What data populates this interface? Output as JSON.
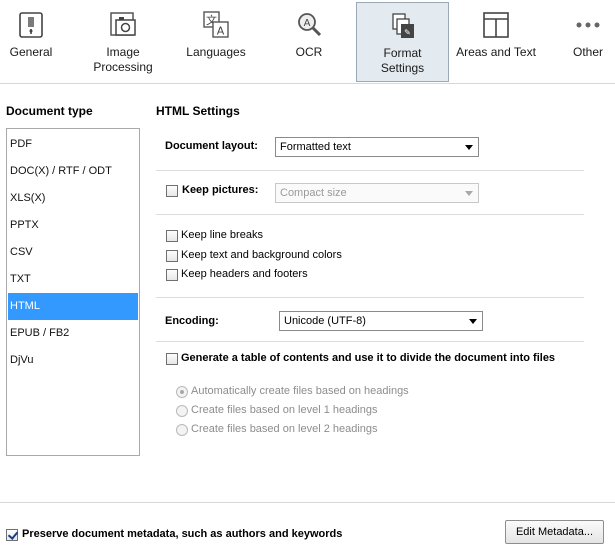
{
  "toolbar": {
    "items": [
      {
        "label": "General",
        "icon": "general-icon"
      },
      {
        "label": "Image\nProcessing",
        "icon": "image-processing-icon"
      },
      {
        "label": "Languages",
        "icon": "languages-icon"
      },
      {
        "label": "OCR",
        "icon": "ocr-icon"
      },
      {
        "label": "Format\nSettings",
        "icon": "format-settings-icon",
        "active": true
      },
      {
        "label": "Areas and Text",
        "icon": "areas-text-icon"
      },
      {
        "label": "Other",
        "icon": "more-icon"
      }
    ]
  },
  "document_type": {
    "title": "Document type",
    "items": [
      "PDF",
      "DOC(X) / RTF / ODT",
      "XLS(X)",
      "PPTX",
      "CSV",
      "TXT",
      "HTML",
      "EPUB / FB2",
      "DjVu"
    ],
    "selected": "HTML"
  },
  "html_settings": {
    "title": "HTML Settings",
    "document_layout_label": "Document layout:",
    "document_layout_value": "Formatted text",
    "keep_pictures_label": "Keep pictures:",
    "keep_pictures_checked": false,
    "keep_pictures_value": "Compact size",
    "keep_line_breaks": "Keep line breaks",
    "keep_colors": "Keep text and background colors",
    "keep_headers": "Keep headers and footers",
    "encoding_label": "Encoding:",
    "encoding_value": "Unicode (UTF-8)",
    "toc_label": "Generate a table of contents and use it to divide the document into files",
    "radio_options": [
      "Automatically create files based on headings",
      "Create files based on level 1 headings",
      "Create files based on level 2 headings"
    ],
    "radio_selected": 0
  },
  "footer": {
    "preserve_metadata_label": "Preserve document metadata, such as authors and keywords",
    "preserve_metadata_checked": true,
    "edit_metadata_button": "Edit Metadata..."
  },
  "colors": {
    "selection": "#3399ff",
    "active_tab": "#e4ebf0"
  }
}
